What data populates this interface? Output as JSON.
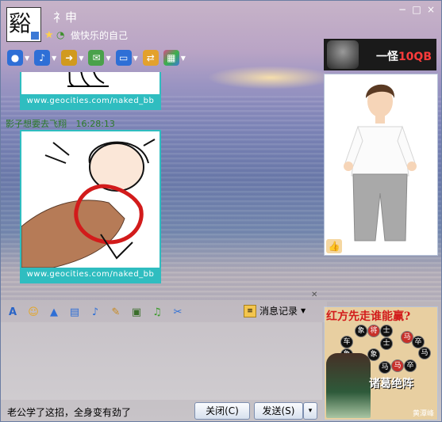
{
  "header": {
    "avatar_glyph": "谿",
    "name": "礻申",
    "signature": "做快乐的自己",
    "window_buttons": [
      "−",
      "□",
      "×"
    ]
  },
  "toolbar": {
    "items": [
      {
        "icon": "video-icon",
        "color": "#2e6fd6"
      },
      {
        "icon": "microphone-icon",
        "color": "#2e6fd6"
      },
      {
        "icon": "file-transfer-icon",
        "color": "#d19a1e"
      },
      {
        "icon": "sms-icon",
        "color": "#4aa14b"
      },
      {
        "icon": "screen-share-icon",
        "color": "#2e6fd6"
      },
      {
        "icon": "remote-assist-icon",
        "color": "#e3a12c"
      },
      {
        "icon": "apps-icon",
        "color": "#d84a8a"
      }
    ]
  },
  "chat": {
    "image1_caption": "www.geocities.com/naked_bb",
    "message_sender": "影子想要去飞翔",
    "message_time": "16:28:13",
    "image2_caption": "www.geocities.com/naked_bb"
  },
  "ad": {
    "text_prefix": "一怪",
    "text_highlight": "10QB"
  },
  "game": {
    "title": "红方先走谁能赢?",
    "subtitle": "诸葛绝阵",
    "credit": "黄潭峰",
    "pieces": [
      "象",
      "将",
      "士",
      "士",
      "车",
      "马",
      "卒",
      "象",
      "马",
      "砲",
      "象",
      "卒",
      "卒",
      "马",
      "马"
    ]
  },
  "input_toolbar": {
    "icons": [
      "font-icon",
      "emoji-icon",
      "magic-icon",
      "window-shake-icon",
      "voice-icon",
      "note-icon",
      "image-icon",
      "music-icon",
      "screenshot-icon"
    ],
    "history_label": "消息记录"
  },
  "input": {
    "message": "老公学了这招，全身变有劲了"
  },
  "buttons": {
    "close_label": "关闭(C)",
    "send_label": "发送(S)",
    "send_arrow": "▾"
  }
}
